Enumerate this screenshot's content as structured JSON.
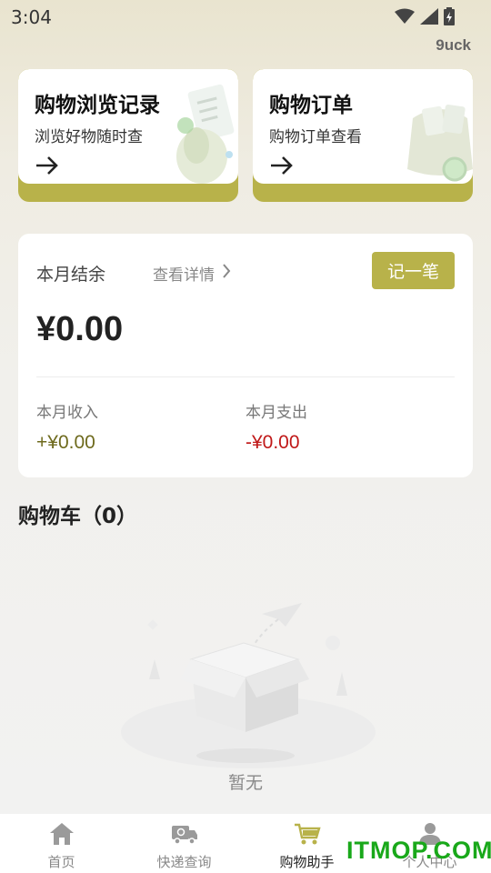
{
  "status_bar": {
    "time": "3:04",
    "icons": [
      "wifi-icon",
      "signal-icon",
      "battery-icon"
    ]
  },
  "brand": "9uck",
  "cards": [
    {
      "title": "购物浏览记录",
      "subtitle": "浏览好物随时查",
      "icon": "arrow-right-icon"
    },
    {
      "title": "购物订单",
      "subtitle": "购物订单查看",
      "icon": "arrow-right-icon"
    }
  ],
  "balance": {
    "label": "本月结余",
    "detail_link": "查看详情",
    "record_button": "记一笔",
    "amount": "¥0.00",
    "income_label": "本月收入",
    "income": "+¥0.00",
    "expense_label": "本月支出",
    "expense": "-¥0.00"
  },
  "cart": {
    "title": "购物车（0）",
    "empty_text": "暂无"
  },
  "tabbar": {
    "items": [
      {
        "label": "首页",
        "icon": "home-icon"
      },
      {
        "label": "快递查询",
        "icon": "delivery-truck-icon"
      },
      {
        "label": "购物助手",
        "icon": "shopping-cart-icon",
        "active": true
      },
      {
        "label": "个人中心",
        "icon": "user-icon"
      }
    ]
  },
  "watermark": "ITMOP.COM",
  "colors": {
    "accent": "#b8b24a",
    "income": "#6e6a1d",
    "expense": "#c01818",
    "watermark": "#19a81a"
  }
}
